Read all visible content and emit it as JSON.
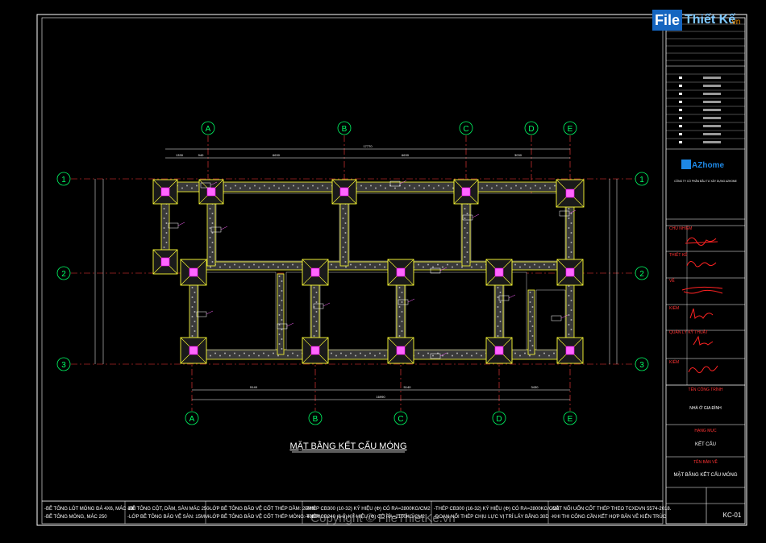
{
  "watermark": {
    "text": "File Thiết Kế.vn",
    "logo_part1": "File",
    "logo_part2": "Thiết Kế",
    "logo_part3": ".vn"
  },
  "drawing": {
    "title": "MẶT BẰNG KẾT CẤU MÓNG",
    "top_axes": [
      "A",
      "B",
      "C",
      "D",
      "E"
    ],
    "bottom_axes": [
      "A",
      "B",
      "C",
      "D",
      "E"
    ],
    "row_axes": [
      "1",
      "2",
      "3"
    ],
    "overall_dim_top": "17770",
    "overall_dim_bottom": "16990",
    "top_dims": [
      "1330",
      "940",
      "6630",
      "6630",
      "3030"
    ],
    "bottom_dims": [
      "5140",
      "5140",
      "3430"
    ],
    "copyright": "Copyright © FileThietKe.vn"
  },
  "title_block": {
    "company_logo": "AZhome",
    "company_sub": "CÔNG TY CỔ PHẦN ĐẦU TƯ XÂY DỰNG AZHOME",
    "chu_nhiem_label": "CHỦ NHIỆM",
    "thiet_ke_label": "THIẾT KẾ",
    "ve_label": "VẼ",
    "kiem_label": "KIỂM",
    "quan_ly_label": "QUẢN LÝ KỸ THUẬT",
    "ten_cong_trinh_label": "TÊN CÔNG TRÌNH",
    "ten_cong_trinh": "NHÀ Ở GIA ĐÌNH",
    "hang_muc_label": "HẠNG MỤC",
    "hang_muc": "KẾT CẤU",
    "ten_ban_ve_label": "TÊN BẢN VẼ",
    "ten_ban_ve": "MẶT BẰNG KẾT CẤU MÓNG",
    "so_ban_ve": "KC-01"
  },
  "notes": [
    "-BÊ TÔNG LÓT MÓNG ĐÁ 4X6, MÁC 100",
    "-BÊ TÔNG MÓNG, MÁC 250",
    "-BÊ TÔNG CỘT, DẦM, SÀN MÁC 250",
    "-LỚP BÊ TÔNG BẢO VỆ SÀN: 15MM",
    "-LỚP BÊ TÔNG BẢO VỆ CỐT THÉP DẦM: 25MM",
    "-LỚP BÊ TÔNG BẢO VỆ CỐT THÉP MÓNG: 40MM",
    "-THÉP CB300 (10-32) KÝ HIỆU (Φ) CÓ RA=2800KG/CM2",
    "-THÉP CB240 (6-8) KÝ HIỆU (Φ) CÓ RA=2100KG/CM2",
    "-THÉP CB300 (16-32) KÝ HIỆU (Φ) CÓ RA=2800KG/CM2",
    "-ĐOẠN NỐI THÉP CHỊU LỰC VỊ TRÍ LẤY BẰNG 30D",
    "-CẮT NỐI UỐN CỐT THÉP THEO TCXDVN 5574-2018.",
    "-KHI THI CÔNG CẦN KẾT HỢP BẢN VẼ KIẾN TRÚC"
  ]
}
